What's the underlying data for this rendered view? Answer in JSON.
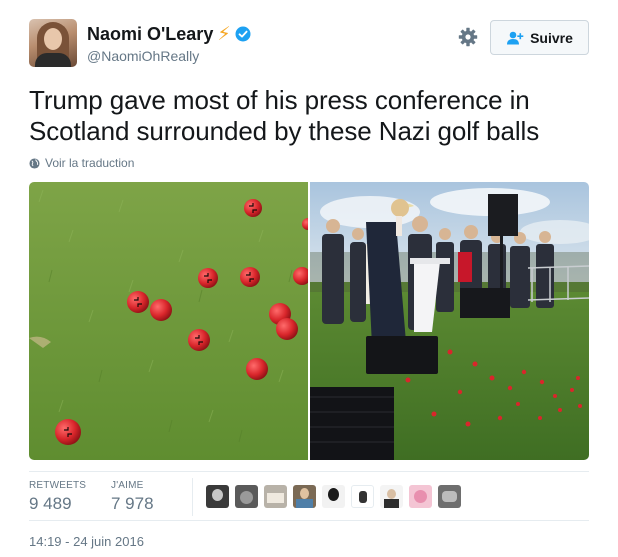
{
  "author": {
    "fullname": "Naomi O'Leary",
    "username": "@NaomiOhReally",
    "badge_emoji": "⚡",
    "verified": true
  },
  "actions": {
    "follow_label": "Suivre",
    "settings_icon": "gear-icon"
  },
  "tweet": {
    "text": "Trump gave most of his press conference in Scotland surrounded by these Nazi golf balls",
    "translate_label": "Voir la traduction",
    "timestamp": "14:19 - 24 juin 2016"
  },
  "stats": {
    "retweets_label": "RETWEETS",
    "retweets_value": "9 489",
    "likes_label": "J'AIME",
    "likes_value": "7 978"
  },
  "likers": [
    {
      "name": "liker-1"
    },
    {
      "name": "liker-2"
    },
    {
      "name": "liker-3"
    },
    {
      "name": "liker-4"
    },
    {
      "name": "liker-5"
    },
    {
      "name": "liker-6"
    },
    {
      "name": "liker-7"
    },
    {
      "name": "liker-8"
    },
    {
      "name": "liker-9"
    }
  ],
  "colors": {
    "accent": "#1da1f2",
    "bolt": "#f5a623",
    "text_secondary": "#657786",
    "grass": "#6f9a3c",
    "ball_red": "#d9262b"
  }
}
